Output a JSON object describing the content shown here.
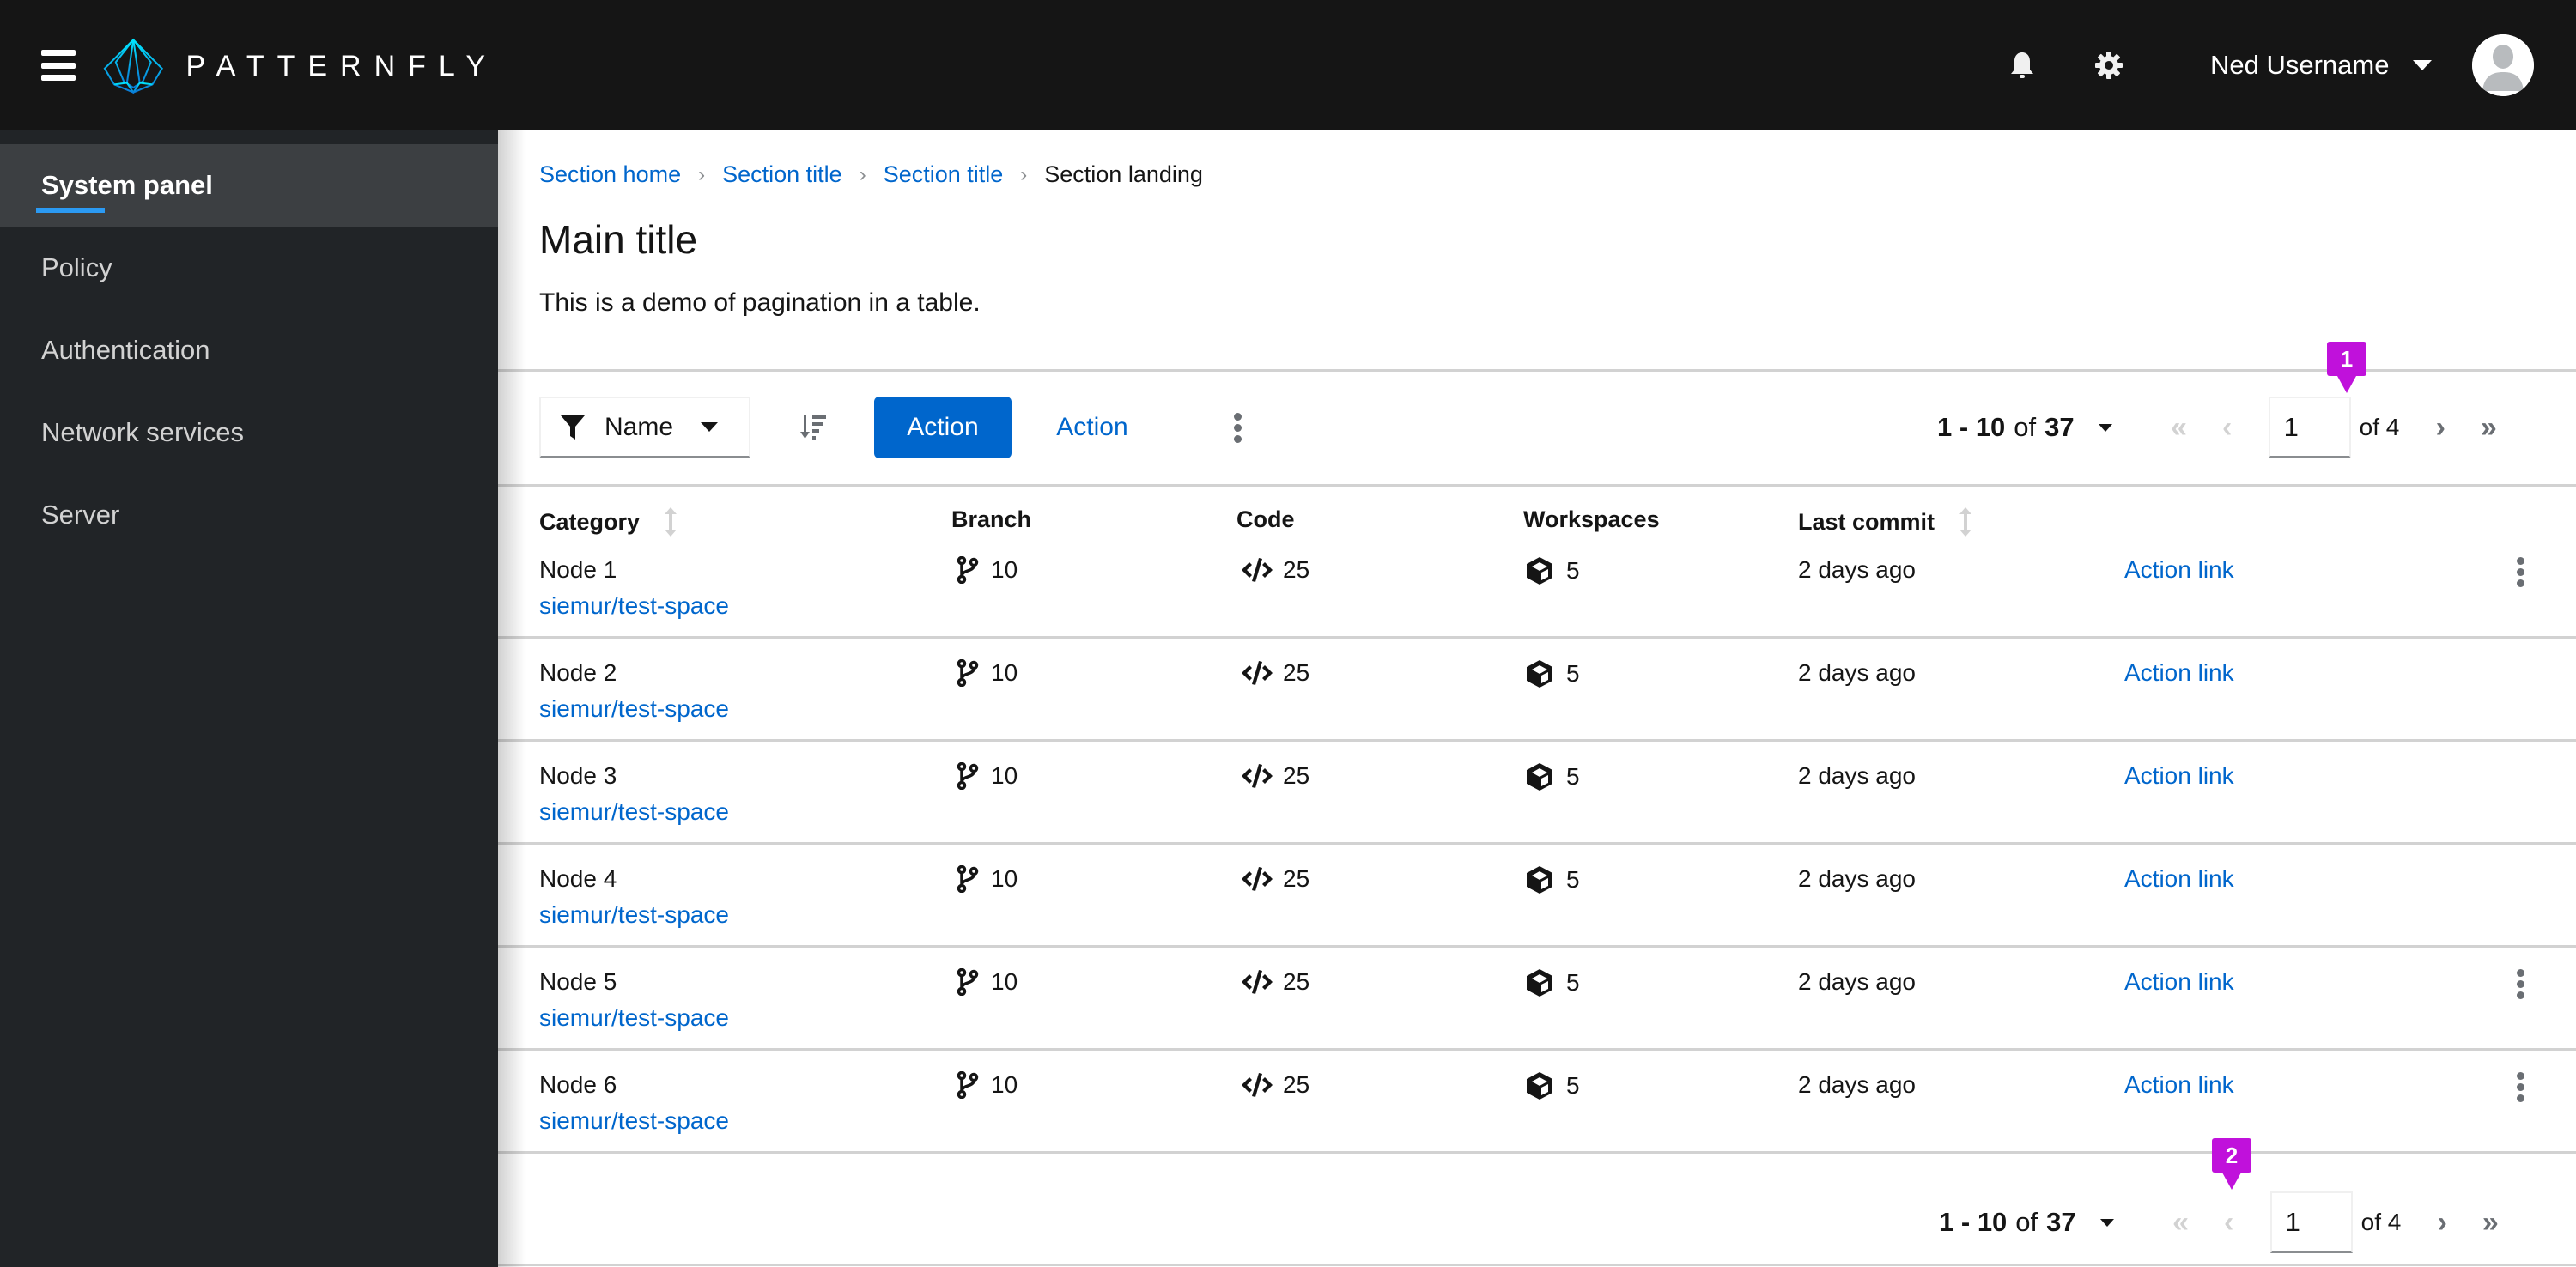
{
  "masthead": {
    "brand": "PATTERNFLY",
    "icons": {
      "menu": "hamburger-icon",
      "notifications": "bell-icon",
      "settings": "gear-icon"
    },
    "user": {
      "name": "Ned Username",
      "avatar": "avatar-icon"
    }
  },
  "sidebar": {
    "items": [
      {
        "label": "System panel",
        "active": true
      },
      {
        "label": "Policy",
        "active": false
      },
      {
        "label": "Authentication",
        "active": false
      },
      {
        "label": "Network services",
        "active": false
      },
      {
        "label": "Server",
        "active": false
      }
    ]
  },
  "breadcrumb": {
    "items": [
      {
        "label": "Section home",
        "link": true
      },
      {
        "label": "Section title",
        "link": true
      },
      {
        "label": "Section title",
        "link": true
      },
      {
        "label": "Section landing",
        "link": false
      }
    ]
  },
  "page": {
    "title": "Main title",
    "description": "This is a demo of pagination in a table."
  },
  "toolbar": {
    "filter_label": "Name",
    "filter_icon": "filter-icon",
    "sort_icon": "sort-amount-down-icon",
    "primary_action": "Action",
    "secondary_action": "Action",
    "kebab_icon": "kebab-icon"
  },
  "pagination_top": {
    "range_start": "1",
    "range_end": "10",
    "of_word": "of",
    "total": "37",
    "current_page": "1",
    "of_pages": "of 4",
    "first_enabled": false,
    "prev_enabled": false,
    "next_enabled": true,
    "last_enabled": true,
    "callout": "1"
  },
  "pagination_bottom": {
    "range_start": "1",
    "range_end": "10",
    "of_word": "of",
    "total": "37",
    "current_page": "1",
    "of_pages": "of 4",
    "first_enabled": false,
    "prev_enabled": false,
    "next_enabled": true,
    "last_enabled": true,
    "callout": "2"
  },
  "table": {
    "columns": [
      {
        "label": "Category",
        "sortable": true
      },
      {
        "label": "Branch",
        "sortable": false
      },
      {
        "label": "Code",
        "sortable": false
      },
      {
        "label": "Workspaces",
        "sortable": false
      },
      {
        "label": "Last commit",
        "sortable": true
      }
    ],
    "rows": [
      {
        "name": "Node 1",
        "repo": "siemur/test-space",
        "branches": "10",
        "code": "25",
        "workspaces": "5",
        "last_commit": "2 days ago",
        "action": "Action link",
        "kebab": true
      },
      {
        "name": "Node 2",
        "repo": "siemur/test-space",
        "branches": "10",
        "code": "25",
        "workspaces": "5",
        "last_commit": "2 days ago",
        "action": "Action link",
        "kebab": false
      },
      {
        "name": "Node 3",
        "repo": "siemur/test-space",
        "branches": "10",
        "code": "25",
        "workspaces": "5",
        "last_commit": "2 days ago",
        "action": "Action link",
        "kebab": false
      },
      {
        "name": "Node 4",
        "repo": "siemur/test-space",
        "branches": "10",
        "code": "25",
        "workspaces": "5",
        "last_commit": "2 days ago",
        "action": "Action link",
        "kebab": false
      },
      {
        "name": "Node 5",
        "repo": "siemur/test-space",
        "branches": "10",
        "code": "25",
        "workspaces": "5",
        "last_commit": "2 days ago",
        "action": "Action link",
        "kebab": true
      },
      {
        "name": "Node 6",
        "repo": "siemur/test-space",
        "branches": "10",
        "code": "25",
        "workspaces": "5",
        "last_commit": "2 days ago",
        "action": "Action link",
        "kebab": true
      }
    ]
  },
  "colors": {
    "masthead_bg": "#151515",
    "sidebar_bg": "#212427",
    "sidebar_active_bg": "#3c3f42",
    "sidebar_active_indicator": "#2b9af3",
    "link": "#0066cc",
    "primary": "#0066cc",
    "callout": "#c011db"
  }
}
